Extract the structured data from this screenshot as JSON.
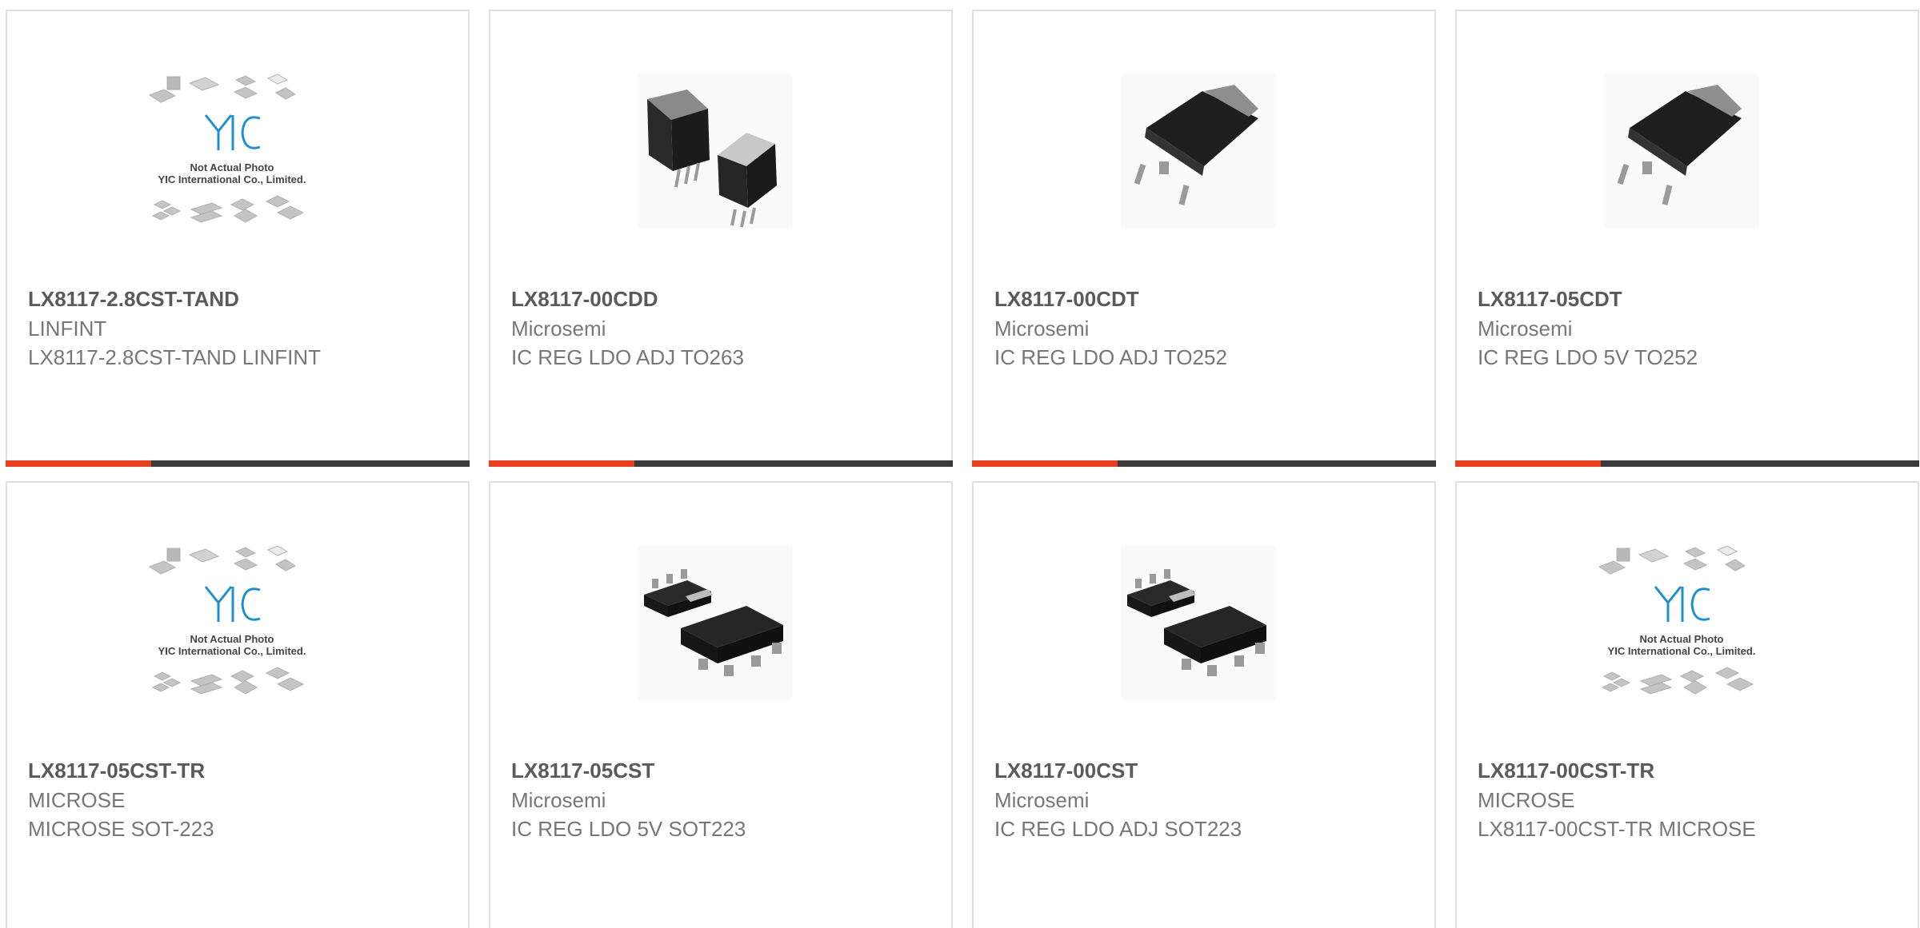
{
  "products": [
    {
      "part": "LX8117-2.8CST-TAND",
      "maker": "LINFINT",
      "desc": "LX8117-2.8CST-TAND LINFINT",
      "image": "placeholder-photo",
      "placeholder_title": "Not Actual Photo",
      "placeholder_company": "YIC International Co., Limited.",
      "logo_text": "YIC"
    },
    {
      "part": "LX8117-00CDD",
      "maker": "Microsemi",
      "desc": "IC REG LDO ADJ TO263",
      "image": "to263-package"
    },
    {
      "part": "LX8117-00CDT",
      "maker": "Microsemi",
      "desc": "IC REG LDO ADJ TO252",
      "image": "to252-package"
    },
    {
      "part": "LX8117-05CDT",
      "maker": "Microsemi",
      "desc": "IC REG LDO 5V TO252",
      "image": "to252-package"
    },
    {
      "part": "LX8117-05CST-TR",
      "maker": "MICROSE",
      "desc": "MICROSE SOT-223",
      "image": "placeholder-photo",
      "placeholder_title": "Not Actual Photo",
      "placeholder_company": "YIC International Co., Limited.",
      "logo_text": "YIC"
    },
    {
      "part": "LX8117-05CST",
      "maker": "Microsemi",
      "desc": "IC REG LDO 5V SOT223",
      "image": "sot223-package"
    },
    {
      "part": "LX8117-00CST",
      "maker": "Microsemi",
      "desc": "IC REG LDO ADJ SOT223",
      "image": "sot223-package"
    },
    {
      "part": "LX8117-00CST-TR",
      "maker": "MICROSE",
      "desc": "LX8117-00CST-TR MICROSE",
      "image": "placeholder-photo",
      "placeholder_title": "Not Actual Photo",
      "placeholder_company": "YIC International Co., Limited.",
      "logo_text": "YIC"
    }
  ],
  "colors": {
    "accent": "#e8401c",
    "bar": "#3b3b3b",
    "border": "#e0e0e0",
    "part_text": "#5a5a5a",
    "secondary_text": "#777777",
    "logo_blue": "#1f8fd0"
  }
}
